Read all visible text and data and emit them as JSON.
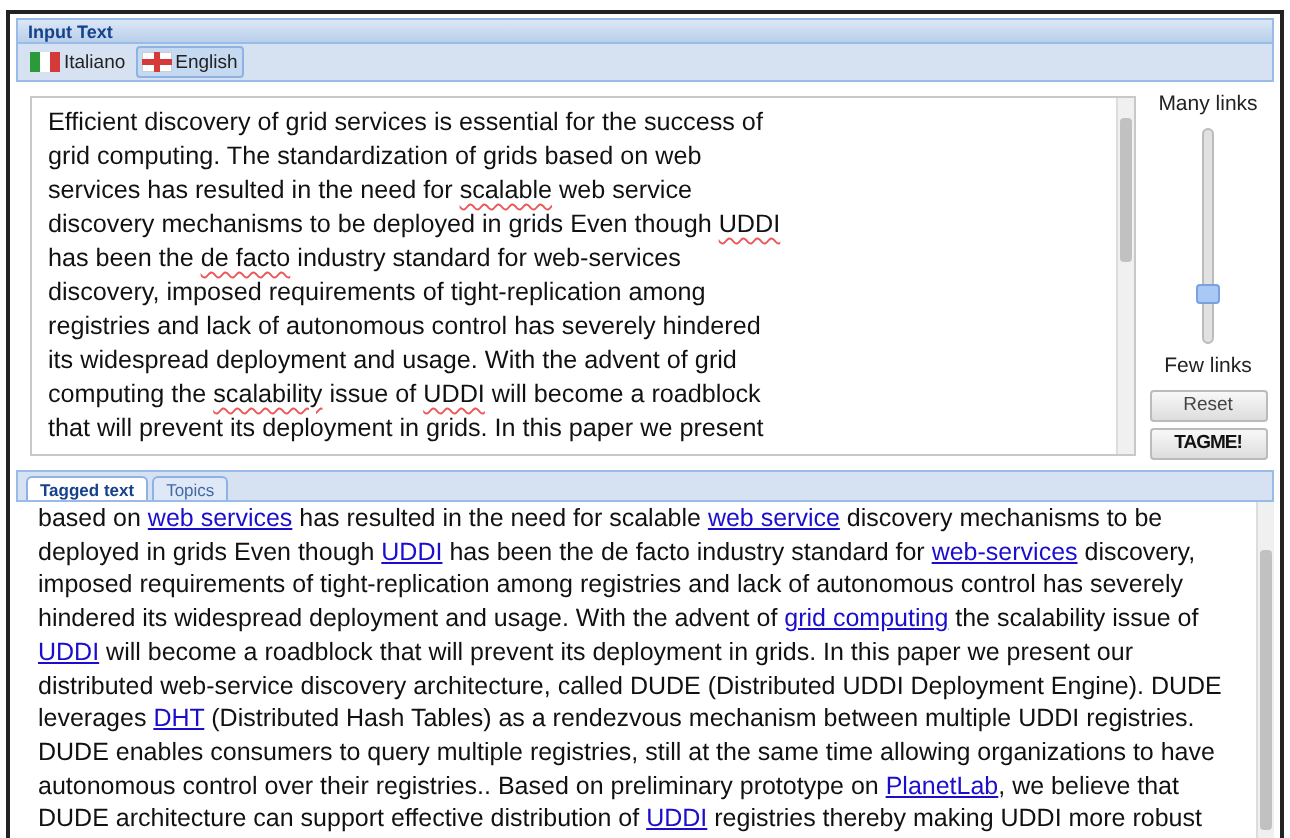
{
  "input_panel": {
    "title": "Input Text",
    "languages": [
      {
        "label": "Italiano",
        "selected": false
      },
      {
        "label": "English",
        "selected": true
      }
    ],
    "text_lines": [
      [
        {
          "text": "Efficient discovery of grid services is essential for the success of"
        }
      ],
      [
        {
          "text": "grid computing. The standardization of grids based on web"
        }
      ],
      [
        {
          "text": "services has resulted in the need for "
        },
        {
          "text": "scalable",
          "misspelled": true
        },
        {
          "text": " web service"
        }
      ],
      [
        {
          "text": "discovery mechanisms to be deployed in grids Even though "
        },
        {
          "text": "UDDI",
          "misspelled": true
        }
      ],
      [
        {
          "text": "has been the "
        },
        {
          "text": "de facto",
          "misspelled": true
        },
        {
          "text": " industry standard for web-services"
        }
      ],
      [
        {
          "text": "discovery, imposed requirements of tight-replication among"
        }
      ],
      [
        {
          "text": "registries and lack of autonomous control has severely hindered"
        }
      ],
      [
        {
          "text": "its widespread deployment and usage. With the advent of grid"
        }
      ],
      [
        {
          "text": "computing the "
        },
        {
          "text": "scalability",
          "misspelled": true
        },
        {
          "text": " issue of "
        },
        {
          "text": "UDDI",
          "misspelled": true
        },
        {
          "text": " will become a roadblock"
        }
      ],
      [
        {
          "text": "that will prevent its deployment in grids. In this paper we present"
        }
      ]
    ],
    "slider": {
      "top_label": "Many links",
      "bottom_label": "Few links",
      "level": 0.2
    },
    "buttons": [
      {
        "label": "Reset",
        "kind": "plain"
      },
      {
        "label": "TAGME!",
        "kind": "bold"
      }
    ]
  },
  "output_panel": {
    "tabs": [
      {
        "label": "Tagged text",
        "selected": true
      },
      {
        "label": "Topics",
        "selected": false
      }
    ],
    "lines": [
      [
        {
          "text": "based on "
        },
        {
          "text": "web services",
          "link": true
        },
        {
          "text": " has resulted in the need for scalable "
        },
        {
          "text": "web service",
          "link": true
        },
        {
          "text": " discovery mechanisms to be"
        }
      ],
      [
        {
          "text": "deployed in grids Even though "
        },
        {
          "text": "UDDI",
          "link": true
        },
        {
          "text": " has been the de facto industry standard for "
        },
        {
          "text": "web-services",
          "link": true
        },
        {
          "text": " discovery,"
        }
      ],
      [
        {
          "text": "imposed requirements of tight-replication among registries and lack of autonomous control has severely"
        }
      ],
      [
        {
          "text": "hindered its widespread deployment and usage. With the advent of "
        },
        {
          "text": "grid computing",
          "link": true
        },
        {
          "text": " the scalability issue of"
        }
      ],
      [
        {
          "text": "UDDI",
          "link": true
        },
        {
          "text": " will become a roadblock that will prevent its deployment in grids. In this paper we present our"
        }
      ],
      [
        {
          "text": "distributed web-service discovery architecture, called DUDE (Distributed UDDI Deployment Engine). DUDE"
        }
      ],
      [
        {
          "text": "leverages "
        },
        {
          "text": "DHT",
          "link": true
        },
        {
          "text": " (Distributed Hash Tables) as a rendezvous mechanism between multiple UDDI registries."
        }
      ],
      [
        {
          "text": "DUDE enables consumers to query multiple registries, still at the same time allowing organizations to have"
        }
      ],
      [
        {
          "text": "autonomous control over their registries.. Based on preliminary prototype on "
        },
        {
          "text": "PlanetLab",
          "link": true
        },
        {
          "text": ", we believe that"
        }
      ],
      [
        {
          "text": "DUDE architecture can support effective distribution of "
        },
        {
          "text": "UDDI",
          "link": true
        },
        {
          "text": " registries thereby making UDDI more robust"
        }
      ]
    ]
  }
}
